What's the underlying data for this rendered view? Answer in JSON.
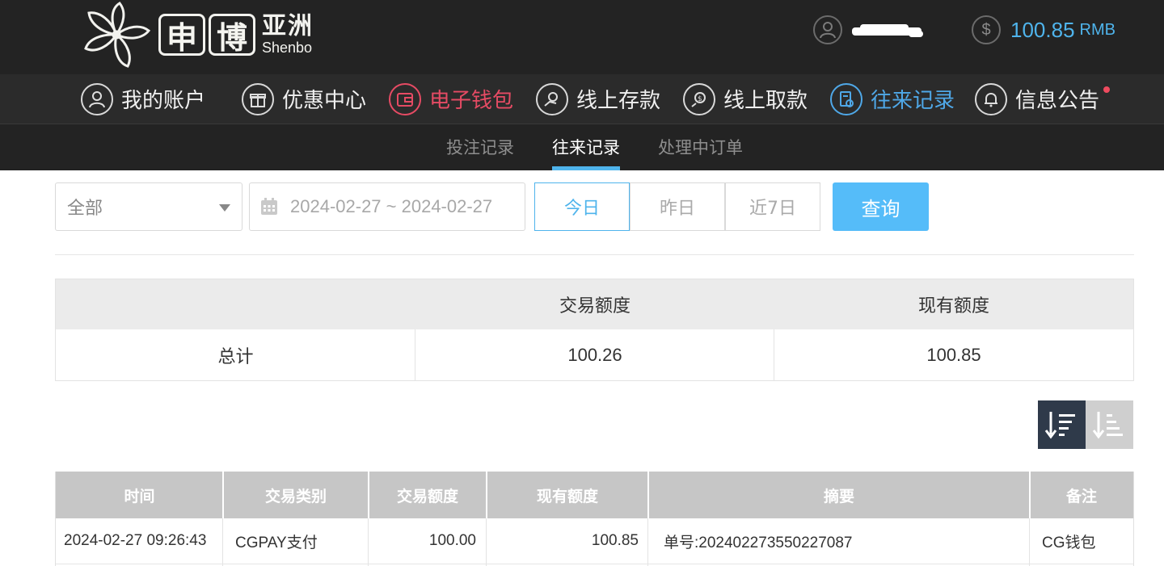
{
  "brand": {
    "cn_char_1": "申",
    "cn_char_2": "博",
    "cn_name": "亚洲",
    "en_name": "Shenbo"
  },
  "account": {
    "balance": "100.85",
    "currency": "RMB",
    "user_icon": "user-icon",
    "balance_icon": "dollar-icon"
  },
  "main_nav": {
    "items": [
      {
        "label": "我的账户",
        "icon": "user-icon"
      },
      {
        "label": "优惠中心",
        "icon": "gift-icon"
      },
      {
        "label": "电子钱包",
        "icon": "wallet-icon"
      },
      {
        "label": "线上存款",
        "icon": "deposit-icon"
      },
      {
        "label": "线上取款",
        "icon": "withdraw-icon"
      },
      {
        "label": "往来记录",
        "icon": "records-icon"
      },
      {
        "label": "信息公告",
        "icon": "bell-icon"
      }
    ],
    "active_index": 5,
    "accent_colors": {
      "active": "#4fa8e8",
      "wallet": "#e64b64"
    }
  },
  "sub_nav": {
    "items": [
      "投注记录",
      "往来记录",
      "处理中订单"
    ],
    "active_index": 1
  },
  "filters": {
    "type_select": "全部",
    "date_range": "2024-02-27 ~ 2024-02-27",
    "ranges": [
      "今日",
      "昨日",
      "近7日"
    ],
    "active_range": "今日",
    "query_label": "查询"
  },
  "summary": {
    "headers": [
      "",
      "交易额度",
      "现有额度"
    ],
    "row": [
      "总计",
      "100.26",
      "100.85"
    ]
  },
  "table": {
    "headers": [
      "时间",
      "交易类别",
      "交易额度",
      "现有额度",
      "摘要",
      "备注"
    ],
    "rows": [
      [
        "2024-02-27 09:26:43",
        "CGPAY支付",
        "100.00",
        "100.85",
        "单号:202402273550227087",
        "CG钱包"
      ]
    ]
  }
}
